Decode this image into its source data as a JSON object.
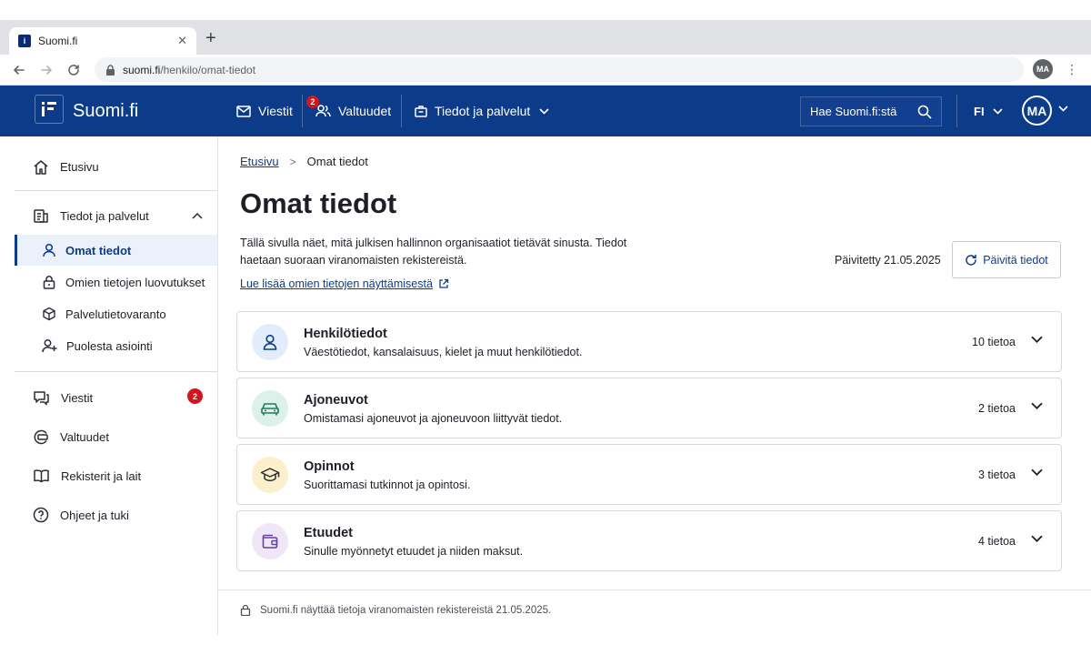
{
  "browser": {
    "tab_title": "Suomi.fi",
    "url_host": "suomi.fi",
    "url_path": "/henkilo/omat-tiedot",
    "profile_initials": "MA"
  },
  "header": {
    "logo_text": "Suomi.fi",
    "nav": {
      "messages": "Viestit",
      "mandates": "Valtuudet",
      "mandates_badge": "2",
      "services": "Tiedot ja palvelut"
    },
    "search_placeholder": "Hae Suomi.fi:stä",
    "language": "FI",
    "user_initials": "MA",
    "brand_color": "#0c3b8a"
  },
  "sidebar": {
    "home": "Etusivu",
    "services_group": "Tiedot ja palvelut",
    "services_items": [
      "Omat tiedot",
      "Omien tietojen luovutukset",
      "Palvelutietovaranto",
      "Puolesta asiointi"
    ],
    "messages": "Viestit",
    "messages_badge": "2",
    "mandates": "Valtuudet",
    "registers": "Rekisterit ja lait",
    "help": "Ohjeet ja tuki"
  },
  "main": {
    "breadcrumb_home": "Etusivu",
    "breadcrumb_current": "Omat tiedot",
    "title": "Omat tiedot",
    "intro": "Tällä sivulla näet, mitä julkisen hallinnon organisaatiot tietävät sinusta. Tiedot haetaan suoraan viranomaisten rekistereistä.",
    "more_link": "Lue lisää omien tietojen näyttämisestä",
    "updated": "Päivitetty 21.05.2025",
    "refresh_button": "Päivitä tiedot",
    "categories": [
      {
        "title": "Henkilötiedot",
        "description": "Väestötiedot, kansalaisuus, kielet ja muut henkilötiedot.",
        "count": "10 tietoa",
        "icon": "person-icon",
        "icon_bg": "#e3ecfa",
        "icon_color": "#0c3b8a"
      },
      {
        "title": "Ajoneuvot",
        "description": "Omistamasi ajoneuvot ja ajoneuvoon liittyvät tiedot.",
        "count": "2 tietoa",
        "icon": "car-icon",
        "icon_bg": "#dcf1ea",
        "icon_color": "#1d7a5c"
      },
      {
        "title": "Opinnot",
        "description": "Suorittamasi tutkinnot ja opintosi.",
        "count": "3 tietoa",
        "icon": "graduation-cap-icon",
        "icon_bg": "#fcf0cc",
        "icon_color": "#2b2b2b"
      },
      {
        "title": "Etuudet",
        "description": "Sinulle myönnetyt etuudet ja niiden maksut.",
        "count": "4 tietoa",
        "icon": "wallet-icon",
        "icon_bg": "#efe6f7",
        "icon_color": "#6b3fa0"
      }
    ],
    "footer_note": "Suomi.fi näyttää tietoja viranomaisten rekistereistä 21.05.2025."
  }
}
